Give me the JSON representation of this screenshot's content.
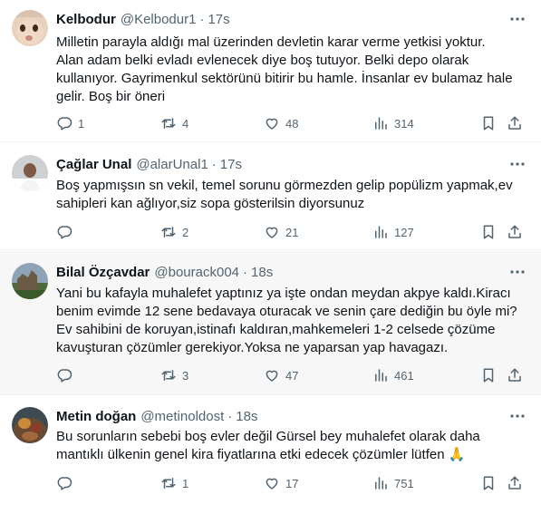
{
  "tweets": [
    {
      "name": "Kelbodur",
      "handle": "@Kelbodur1",
      "separator": "·",
      "time": "17s",
      "lines": [
        "Milletin parayla aldığı mal üzerinden devletin karar verme yetkisi yoktur.",
        "Alan adam belki evladı evlenecek diye boş tutuyor. Belki depo  olarak",
        "kullanıyor. Gayrimenkul sektörünü bitirir bu hamle. İnsanlar ev bulamaz hale",
        "gelir. Boş bir öneri"
      ],
      "replies": "1",
      "retweets": "4",
      "likes": "48",
      "views": "314"
    },
    {
      "name": "Çağlar Unal",
      "handle": "@alarUnal1",
      "separator": "·",
      "time": "17s",
      "lines": [
        "Boş yapmışsın sn vekil, temel sorunu görmezden gelip popülizm yapmak,ev",
        "sahipleri kan ağlıyor,siz sopa gösterilsin diyorsunuz"
      ],
      "replies": "",
      "retweets": "2",
      "likes": "21",
      "views": "127"
    },
    {
      "name": "Bilal Özçavdar",
      "handle": "@bourack004",
      "separator": "·",
      "time": "18s",
      "lines": [
        "Yani bu kafayla muhalefet yaptınız ya işte ondan meydan akpye kaldı.Kiracı",
        "benim evimde 12 sene bedavaya oturacak ve senin çare dediğin bu öyle mi?",
        "Ev sahibini de koruyan,istinafı kaldıran,mahkemeleri 1-2 celsede çözüme",
        "kavuşturan çözümler gerekiyor.Yoksa ne yaparsan yap havagazı."
      ],
      "replies": "",
      "retweets": "3",
      "likes": "47",
      "views": "461"
    },
    {
      "name": "Metin doğan",
      "handle": "@metinoldost",
      "separator": "·",
      "time": "18s",
      "lines": [
        "Bu sorunların sebebi boş evler değil Gürsel bey muhalefet olarak daha",
        "mantıklı ülkenin genel kira fiyatlarına etki edecek çözümler lütfen 🙏"
      ],
      "replies": "",
      "retweets": "1",
      "likes": "17",
      "views": "751"
    }
  ],
  "colors": {
    "text": "#0f1419",
    "muted": "#536471",
    "divider": "#eff3f4",
    "highlight_bg": "#f7f7f7"
  },
  "icons": [
    "more-icon",
    "reply-icon",
    "retweet-icon",
    "like-icon",
    "views-icon",
    "bookmark-icon",
    "share-icon"
  ]
}
